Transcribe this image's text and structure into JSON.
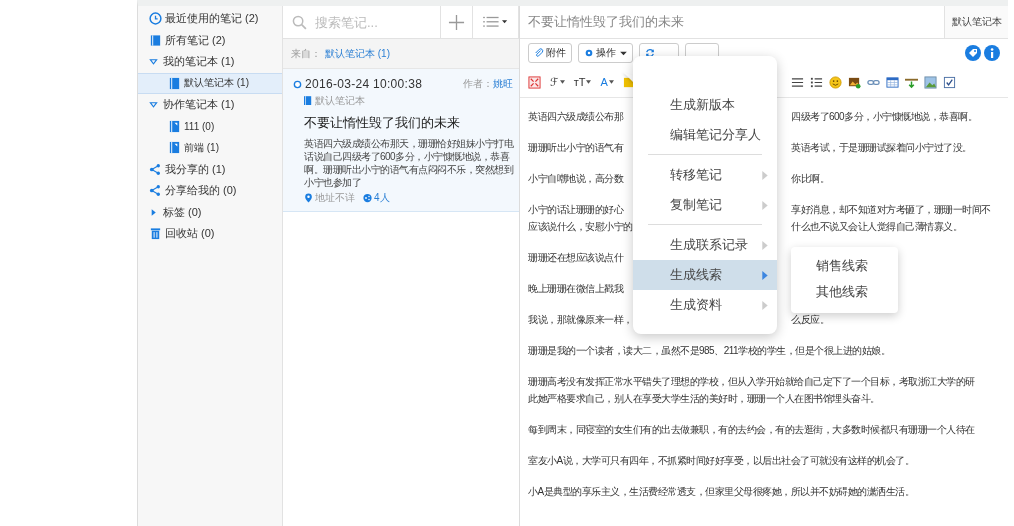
{
  "sidebar": {
    "items": [
      {
        "kind": "recent",
        "label": "最近使用的笔记",
        "count": "(2)",
        "selected": false
      },
      {
        "kind": "all",
        "label": "所有笔记",
        "count": "(2)",
        "selected": false
      },
      {
        "kind": "group",
        "label": "我的笔记本",
        "count": "(1)",
        "expanded": true,
        "selected": false,
        "children": [
          {
            "kind": "notebook",
            "label": "默认笔记本",
            "count": "(1)",
            "selected": true
          }
        ]
      },
      {
        "kind": "group",
        "label": "协作笔记本",
        "count": "(1)",
        "expanded": true,
        "selected": false,
        "children": [
          {
            "kind": "shared-notebook",
            "label": "111",
            "count": "(0)",
            "selected": false
          },
          {
            "kind": "shared-notebook",
            "label": "前端",
            "count": "(1)",
            "selected": false
          }
        ]
      },
      {
        "kind": "shared",
        "label": "我分享的",
        "count": "(1)",
        "selected": false
      },
      {
        "kind": "shared",
        "label": "分享给我的",
        "count": "(0)",
        "selected": false
      },
      {
        "kind": "group",
        "label": "标签",
        "count": "(0)",
        "expanded": false,
        "selected": false
      },
      {
        "kind": "trash",
        "label": "回收站",
        "count": "(0)",
        "selected": false
      }
    ]
  },
  "note_list": {
    "search": {
      "placeholder": "搜索笔记..."
    },
    "source_label": "来自：",
    "source": "默认笔记本 (1)",
    "notes": [
      {
        "date": "2016-03-24 10:00:38",
        "author_label": "作者：",
        "author": "姚旺",
        "notebook": "默认笔记本",
        "title": "不要让惰性毁了我们的未来",
        "snippet": "英语四六级成绩公布那天，珊珊恰好姐妹小宁打电话说自己四级考了600多分，小宁慷慨地说，恭喜啊。珊珊听出小宁的语气有点闷闷不乐，突然想到小宁也参加了",
        "location": "地址不详",
        "shares": "4人",
        "selected": true
      }
    ]
  },
  "editor": {
    "title": "不要让惰性毁了我们的未来",
    "notebook": "默认笔记本",
    "buttons": [
      {
        "kind": "attach",
        "label": "附件"
      },
      {
        "kind": "actions",
        "label": "操作"
      },
      {
        "kind": "sync"
      },
      {
        "kind": "blank"
      }
    ],
    "format_left": [
      {
        "kind": "fullscreen"
      },
      {
        "kind": "glyph",
        "label": "ℱ"
      },
      {
        "kind": "glyph",
        "label": "тT"
      },
      {
        "kind": "color",
        "label": "A"
      },
      {
        "kind": "highlight"
      }
    ],
    "format_right": [
      {
        "kind": "numbered-list"
      },
      {
        "kind": "bullet-list"
      },
      {
        "kind": "emoji"
      },
      {
        "kind": "image-add"
      },
      {
        "kind": "link"
      },
      {
        "kind": "table"
      },
      {
        "kind": "insert-line"
      },
      {
        "kind": "image"
      },
      {
        "kind": "checkbox"
      }
    ],
    "paragraphs": [
      {
        "lines": [
          {
            "left": "英语四六级成绩公布那",
            "right": "四级考了600多分，小宁慷慨地说，恭喜啊。"
          }
        ]
      },
      {
        "lines": [
          {
            "left": "珊珊听出小宁的语气有",
            "right": "英语考试，于是珊珊试探着问小宁过了没。"
          }
        ]
      },
      {
        "lines": [
          {
            "left": "小宁自嘲地说，高分数",
            "right": "你比啊。"
          }
        ]
      },
      {
        "lines": [
          {
            "left": "小宁的话让珊珊的好心",
            "right": "享好消息，却不知道对方考砸了，珊珊一时间不"
          },
          {
            "left": "应该说什么，安慰小宁的",
            "right": "什么也不说又会让人觉得自己薄情寡义。"
          }
        ]
      },
      {
        "lines": [
          {
            "left": "珊珊还在想应该说点什"
          }
        ]
      },
      {
        "lines": [
          {
            "left": "晚上珊珊在微信上戳我"
          }
        ]
      },
      {
        "lines": [
          {
            "left": "我说，那就像原来一样，",
            "right": "么反应。"
          }
        ]
      },
      {
        "lines": [
          {
            "left": "珊珊是我的一个读者，读大二，虽然不是985、211学校的学生，但是个很上进的姑娘。"
          }
        ]
      },
      {
        "lines": [
          {
            "left": "珊珊高考没有发挥正常水平错失了理想的学校，但从入学开始就给自己定下了一个目标，考取浙江大学的研"
          },
          {
            "left": "此她严格要求自己，别人在享受大学生活的美好时，珊珊一个人在图书馆埋头奋斗。"
          }
        ]
      },
      {
        "lines": [
          {
            "left": "每到周末，同寝室的女生们有的出去做兼职，有的去约会，有的去逛街，大多数时候都只有珊珊一个人待在"
          }
        ]
      },
      {
        "lines": [
          {
            "left": "室友小A说，大学可只有四年，不抓紧时间好好享受，以后出社会了可就没有这样的机会了。"
          }
        ]
      },
      {
        "lines": [
          {
            "left": "小A是典型的享乐主义，生活费经常透支，但家里父母很疼她，所以并不妨碍她的潇洒生活。"
          }
        ]
      }
    ]
  },
  "menu": {
    "items": [
      {
        "label": "生成新版本",
        "submenu": false,
        "divider_before": false,
        "selected": false
      },
      {
        "label": "编辑笔记分享人",
        "submenu": false,
        "divider_before": false,
        "selected": false
      },
      {
        "label": "转移笔记",
        "submenu": true,
        "divider_before": true,
        "selected": false
      },
      {
        "label": "复制笔记",
        "submenu": true,
        "divider_before": false,
        "selected": false
      },
      {
        "label": "生成联系记录",
        "submenu": true,
        "divider_before": true,
        "selected": false
      },
      {
        "label": "生成线索",
        "submenu": true,
        "divider_before": false,
        "selected": true
      },
      {
        "label": "生成资料",
        "submenu": true,
        "divider_before": false,
        "selected": false
      }
    ],
    "submenu": {
      "items": [
        {
          "label": "销售线索"
        },
        {
          "label": "其他线索"
        }
      ]
    }
  }
}
